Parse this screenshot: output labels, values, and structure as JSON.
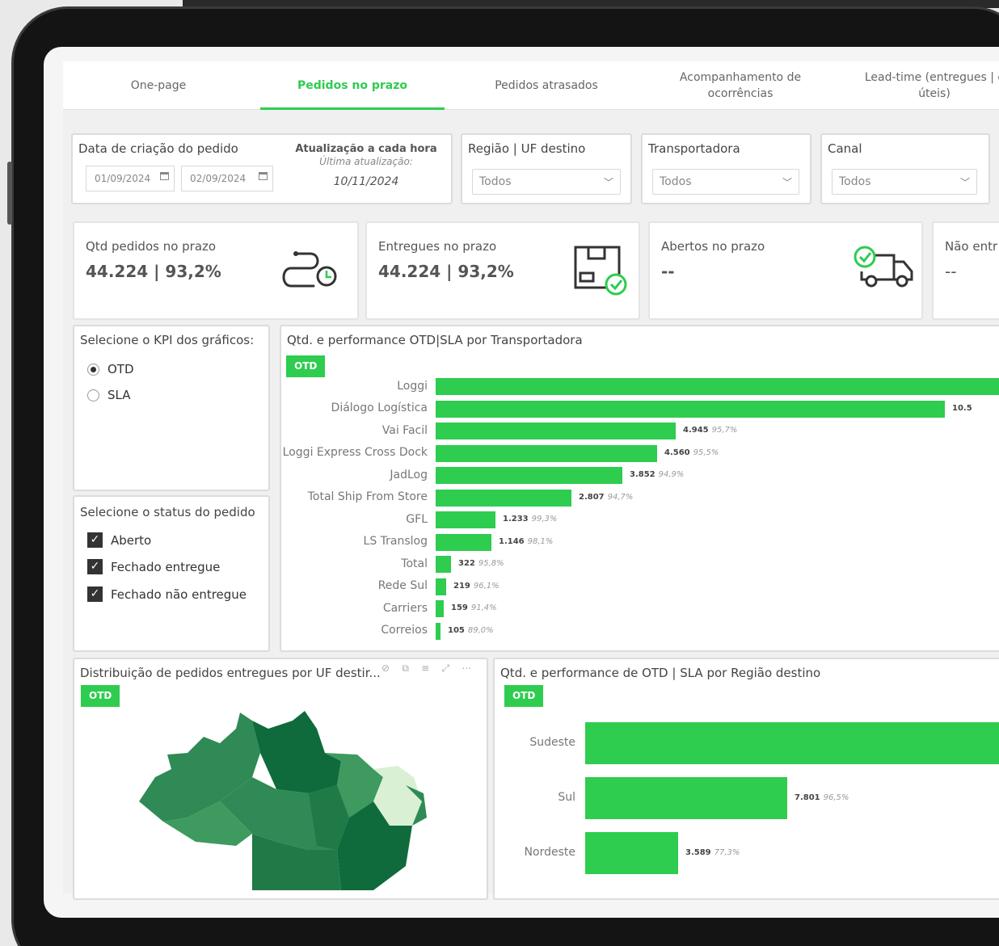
{
  "tabs": [
    {
      "label": "One-page"
    },
    {
      "label": "Pedidos no prazo"
    },
    {
      "label": "Pedidos atrasados"
    },
    {
      "label": "Acompanhamento de\nocorrências"
    },
    {
      "label": "Lead-time (entregues | c\núteis)"
    }
  ],
  "filters": {
    "date_title": "Data de criação do pedido",
    "date_from": "01/09/2024",
    "date_to": "02/09/2024",
    "update_title": "Atualização a cada hora",
    "update_sub": "Última atualização:",
    "update_date": "10/11/2024",
    "region_title": "Região | UF destino",
    "region_value": "Todos",
    "carrier_title": "Transportadora",
    "carrier_value": "Todos",
    "channel_title": "Canal",
    "channel_value": "Todos"
  },
  "kpis": [
    {
      "label": "Qtd pedidos no prazo",
      "value": "44.224 | 93,2%",
      "icon": "route-clock-icon"
    },
    {
      "label": "Entregues no prazo",
      "value": "44.224 | 93,2%",
      "icon": "box-check-icon"
    },
    {
      "label": "Abertos no prazo",
      "value": "--",
      "icon": "truck-check-icon"
    },
    {
      "label": "Não entr",
      "value": "--"
    }
  ],
  "kpi_selector": {
    "title": "Selecione o KPI dos gráficos:",
    "options": [
      "OTD",
      "SLA"
    ],
    "selected": "OTD"
  },
  "status_selector": {
    "title": "Selecione o status do pedido",
    "options": [
      "Aberto",
      "Fechado entregue",
      "Fechado não entregue"
    ]
  },
  "chart_carrier": {
    "title": "Qtd. e performance OTD|SLA por Transportadora",
    "badge": "OTD"
  },
  "chart_map": {
    "title": "Distribuição de pedidos entregues por UF destir...",
    "badge": "OTD"
  },
  "chart_region": {
    "title": "Qtd. e performance de OTD | SLA por Região destino",
    "badge": "OTD"
  },
  "colors": {
    "accent": "#2ecc4f",
    "map_dark": "#0f6b3b",
    "map_mid": "#2f8a55",
    "map_light": "#d9f0d5"
  },
  "chart_data": [
    {
      "type": "bar",
      "orientation": "horizontal",
      "categories": [
        "Loggi",
        "Diálogo Logística",
        "Vai Facil",
        "Loggi Express Cross Dock",
        "JadLog",
        "Total Ship From Store",
        "GFL",
        "LS Translog",
        "Total",
        "Rede Sul",
        "Carriers",
        "Correios"
      ],
      "values": [
        12000,
        10500,
        4945,
        4560,
        3852,
        2807,
        1233,
        1146,
        322,
        219,
        159,
        105
      ],
      "value_labels": [
        "",
        "10.5",
        "4.945",
        "4.560",
        "3.852",
        "2.807",
        "1.233",
        "1.146",
        "322",
        "219",
        "159",
        "105"
      ],
      "pct_labels": [
        "",
        "",
        "95,7%",
        "95,5%",
        "94,9%",
        "94,7%",
        "99,3%",
        "98,1%",
        "95,8%",
        "96,1%",
        "91,4%",
        "89,0%"
      ],
      "xlim": [
        0,
        12000
      ]
    },
    {
      "type": "bar",
      "orientation": "horizontal",
      "categories": [
        "Sudeste",
        "Sul",
        "Nordeste"
      ],
      "values": [
        20000,
        7801,
        3589
      ],
      "value_labels": [
        "",
        "7.801",
        "3.589"
      ],
      "pct_labels": [
        "",
        "96,5%",
        "77,3%"
      ],
      "xlim": [
        0,
        20000
      ]
    }
  ]
}
